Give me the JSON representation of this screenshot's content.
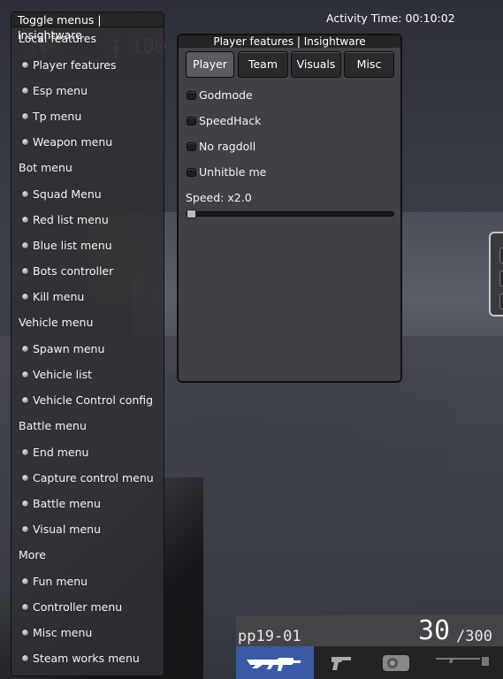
{
  "activity": {
    "label": "Activity Time:",
    "value": "00:10:02"
  },
  "hud_stats": {
    "left_value": "100",
    "right_value": "100",
    "color": "#d06a6a"
  },
  "left_menu": {
    "title": "Toggle menus | Insightware",
    "sections": [
      {
        "label": "Local features",
        "items": [
          "Player features",
          "Esp menu",
          "Tp menu",
          "Weapon menu"
        ]
      },
      {
        "label": "Bot menu",
        "items": [
          "Squad Menu",
          "Red list menu",
          "Blue list menu",
          "Bots controller",
          "Kill menu"
        ]
      },
      {
        "label": "Vehicle menu",
        "items": [
          "Spawn menu",
          "Vehicle list",
          "Vehicle Control config"
        ]
      },
      {
        "label": "Battle menu",
        "items": [
          "End menu",
          "Capture control menu",
          "Battle menu",
          "Visual menu"
        ]
      },
      {
        "label": "More",
        "items": [
          "Fun menu",
          "Controller menu",
          "Misc menu",
          "Steam works menu"
        ]
      }
    ]
  },
  "player_window": {
    "title": "Player features | Insightware",
    "tabs": [
      "Player",
      "Team",
      "Visuals",
      "Misc"
    ],
    "active_tab": "Player",
    "options": [
      {
        "label": "Godmode",
        "checked": false
      },
      {
        "label": "SpeedHack",
        "checked": false
      },
      {
        "label": "No ragdoll",
        "checked": false
      },
      {
        "label": "Unhitble me",
        "checked": false
      }
    ],
    "speed_label": "Speed: x2.0",
    "speed_slider_fraction": 0.0
  },
  "weapon": {
    "name": "pp19-01",
    "ammo": "30",
    "reserve": "/300",
    "slots": [
      "rifle-icon",
      "pistol-icon",
      "grenade-icon",
      "melee-icon"
    ],
    "active_slot": 0,
    "active_color": "#3b5aa6"
  }
}
